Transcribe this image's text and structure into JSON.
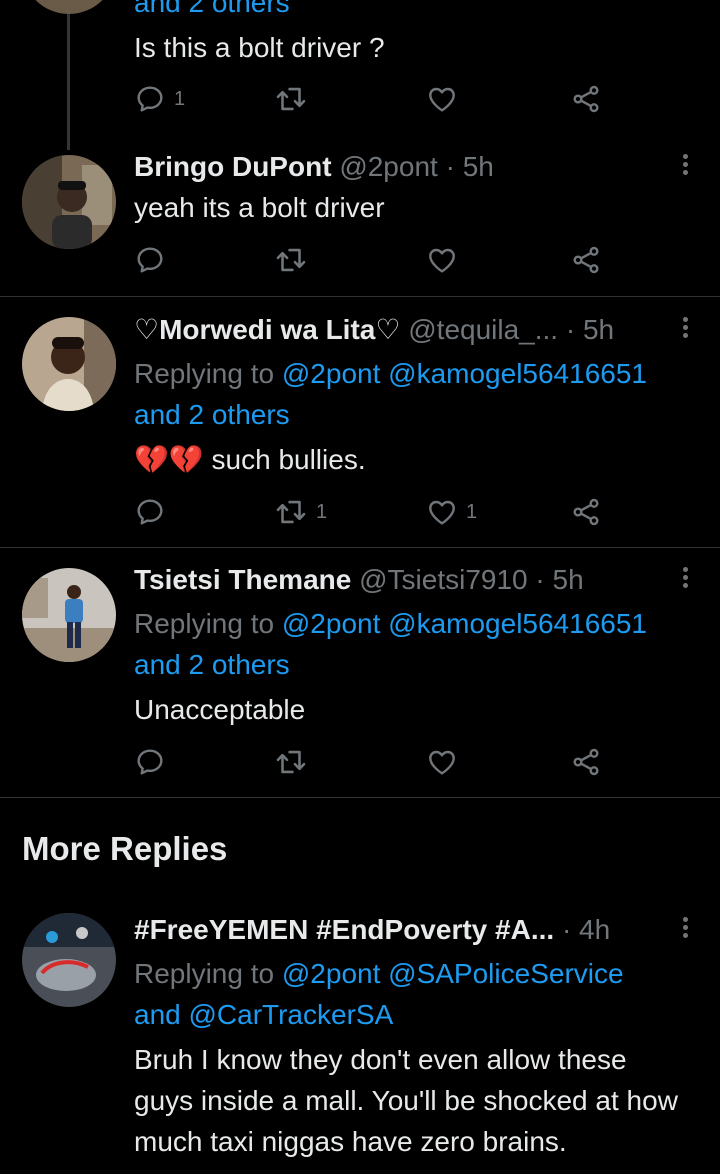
{
  "top_partial": {
    "reply_text": "and 2 others",
    "body": "Is this a bolt driver ?",
    "reply_count": "1"
  },
  "tweet1": {
    "name": "Bringo DuPont",
    "handle": "@2pont",
    "dot": "·",
    "time": "5h",
    "body": "yeah its a bolt driver"
  },
  "tweet2": {
    "name": "♡Morwedi wa Lita♡",
    "handle": "@tequila_...",
    "dot": "·",
    "time": "5h",
    "replying_prefix": "Replying to",
    "mention1": "@2pont",
    "mention2": "@kamogel56416651",
    "mention3": "and 2 others",
    "body_emoji": "💔💔",
    "body": " such bullies.",
    "retweet_count": "1",
    "like_count": "1"
  },
  "tweet3": {
    "name": "Tsietsi Themane",
    "handle": "@Tsietsi7910",
    "dot": "·",
    "time": "5h",
    "replying_prefix": "Replying to",
    "mention1": "@2pont",
    "mention2": "@kamogel56416651",
    "mention3": "and 2 others",
    "body": "Unacceptable"
  },
  "more_replies": {
    "title": "More Replies"
  },
  "tweet4": {
    "name": "#FreeYEMEN #EndPoverty #A...",
    "dot": "·",
    "time": "4h",
    "replying_prefix": "Replying to",
    "mention1": "@2pont",
    "mention2": "@SAPoliceService",
    "mention3": "and @CarTrackerSA",
    "body": "Bruh I know they don't even allow these guys inside a mall. You'll be shocked at how much taxi niggas have zero brains."
  },
  "colors": {
    "background": "#000000",
    "text": "#e7e9ea",
    "secondary": "#71767b",
    "link": "#1d9bf0",
    "divider": "#2f3336"
  },
  "icons": [
    "reply-icon",
    "retweet-icon",
    "like-icon",
    "share-icon",
    "more-icon"
  ]
}
